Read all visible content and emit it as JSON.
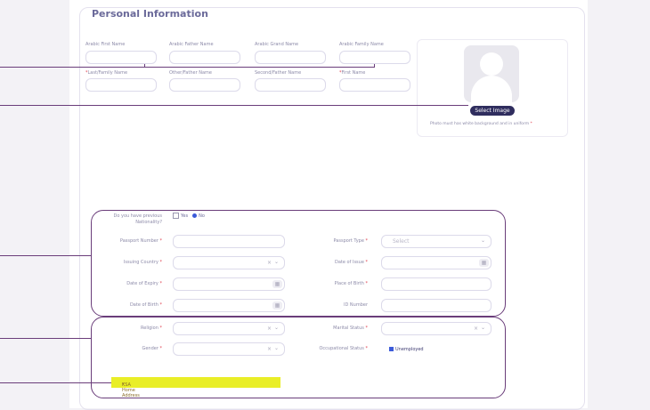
{
  "section": {
    "title": "Personal Information"
  },
  "name_fields": {
    "row1": [
      {
        "label": "Arabic First Name",
        "required": ""
      },
      {
        "label": "Arabic Father Name",
        "required": ""
      },
      {
        "label": "Arabic Grand Name",
        "required": ""
      },
      {
        "label": "Arabic Family Name",
        "required": ""
      }
    ],
    "row2": [
      {
        "label": "Last/Family Name",
        "required": "*"
      },
      {
        "label": "Other/Father Name",
        "required": ""
      },
      {
        "label": "Second/Father Name",
        "required": ""
      },
      {
        "label": "First Name",
        "required": "*"
      }
    ]
  },
  "photo": {
    "button_label": "Select Image",
    "note": "Photo must has white background and in uniform",
    "note_required": "*"
  },
  "nationality": {
    "question": "Do you have previous",
    "question2": "Nationality?",
    "yes_label": "Yes",
    "no_label": "No",
    "selected": "No"
  },
  "passport": {
    "passport_number": {
      "label": "Passport Number",
      "required": "*"
    },
    "passport_type": {
      "label": "Passport Type",
      "required": "*",
      "placeholder": "Select"
    },
    "issuing_country": {
      "label": "Issuing Country",
      "required": "*",
      "clear": "×",
      "chevron": "⌄"
    },
    "date_of_issue": {
      "label": "Date of Issue",
      "required": "*"
    },
    "date_of_expiry": {
      "label": "Date of Expiry",
      "required": "*"
    },
    "place_of_birth": {
      "label": "Place of Birth",
      "required": "*"
    },
    "date_of_birth": {
      "label": "Date of Birth",
      "required": "*"
    },
    "id_number": {
      "label": "ID Number",
      "required": ""
    }
  },
  "personal": {
    "religion": {
      "label": "Religion",
      "required": "*",
      "clear": "×",
      "chevron": "⌄"
    },
    "marital_status": {
      "label": "Marital Status",
      "required": "*",
      "clear": "×",
      "chevron": "⌄"
    },
    "gender": {
      "label": "Gender",
      "required": "*",
      "clear": "×",
      "chevron": "⌄"
    },
    "occupational_status": {
      "label": "Occupational Status",
      "required": "*",
      "value": "Unemployed"
    },
    "ksa_home_address": {
      "label": "KSA Home Address",
      "required": "*"
    }
  },
  "icons": {
    "calendar": "▦"
  },
  "colors": {
    "accent": "#2f2d5e",
    "annotation": "#6a3d7a",
    "highlight": "#e9ee27",
    "required": "#e0404f"
  }
}
